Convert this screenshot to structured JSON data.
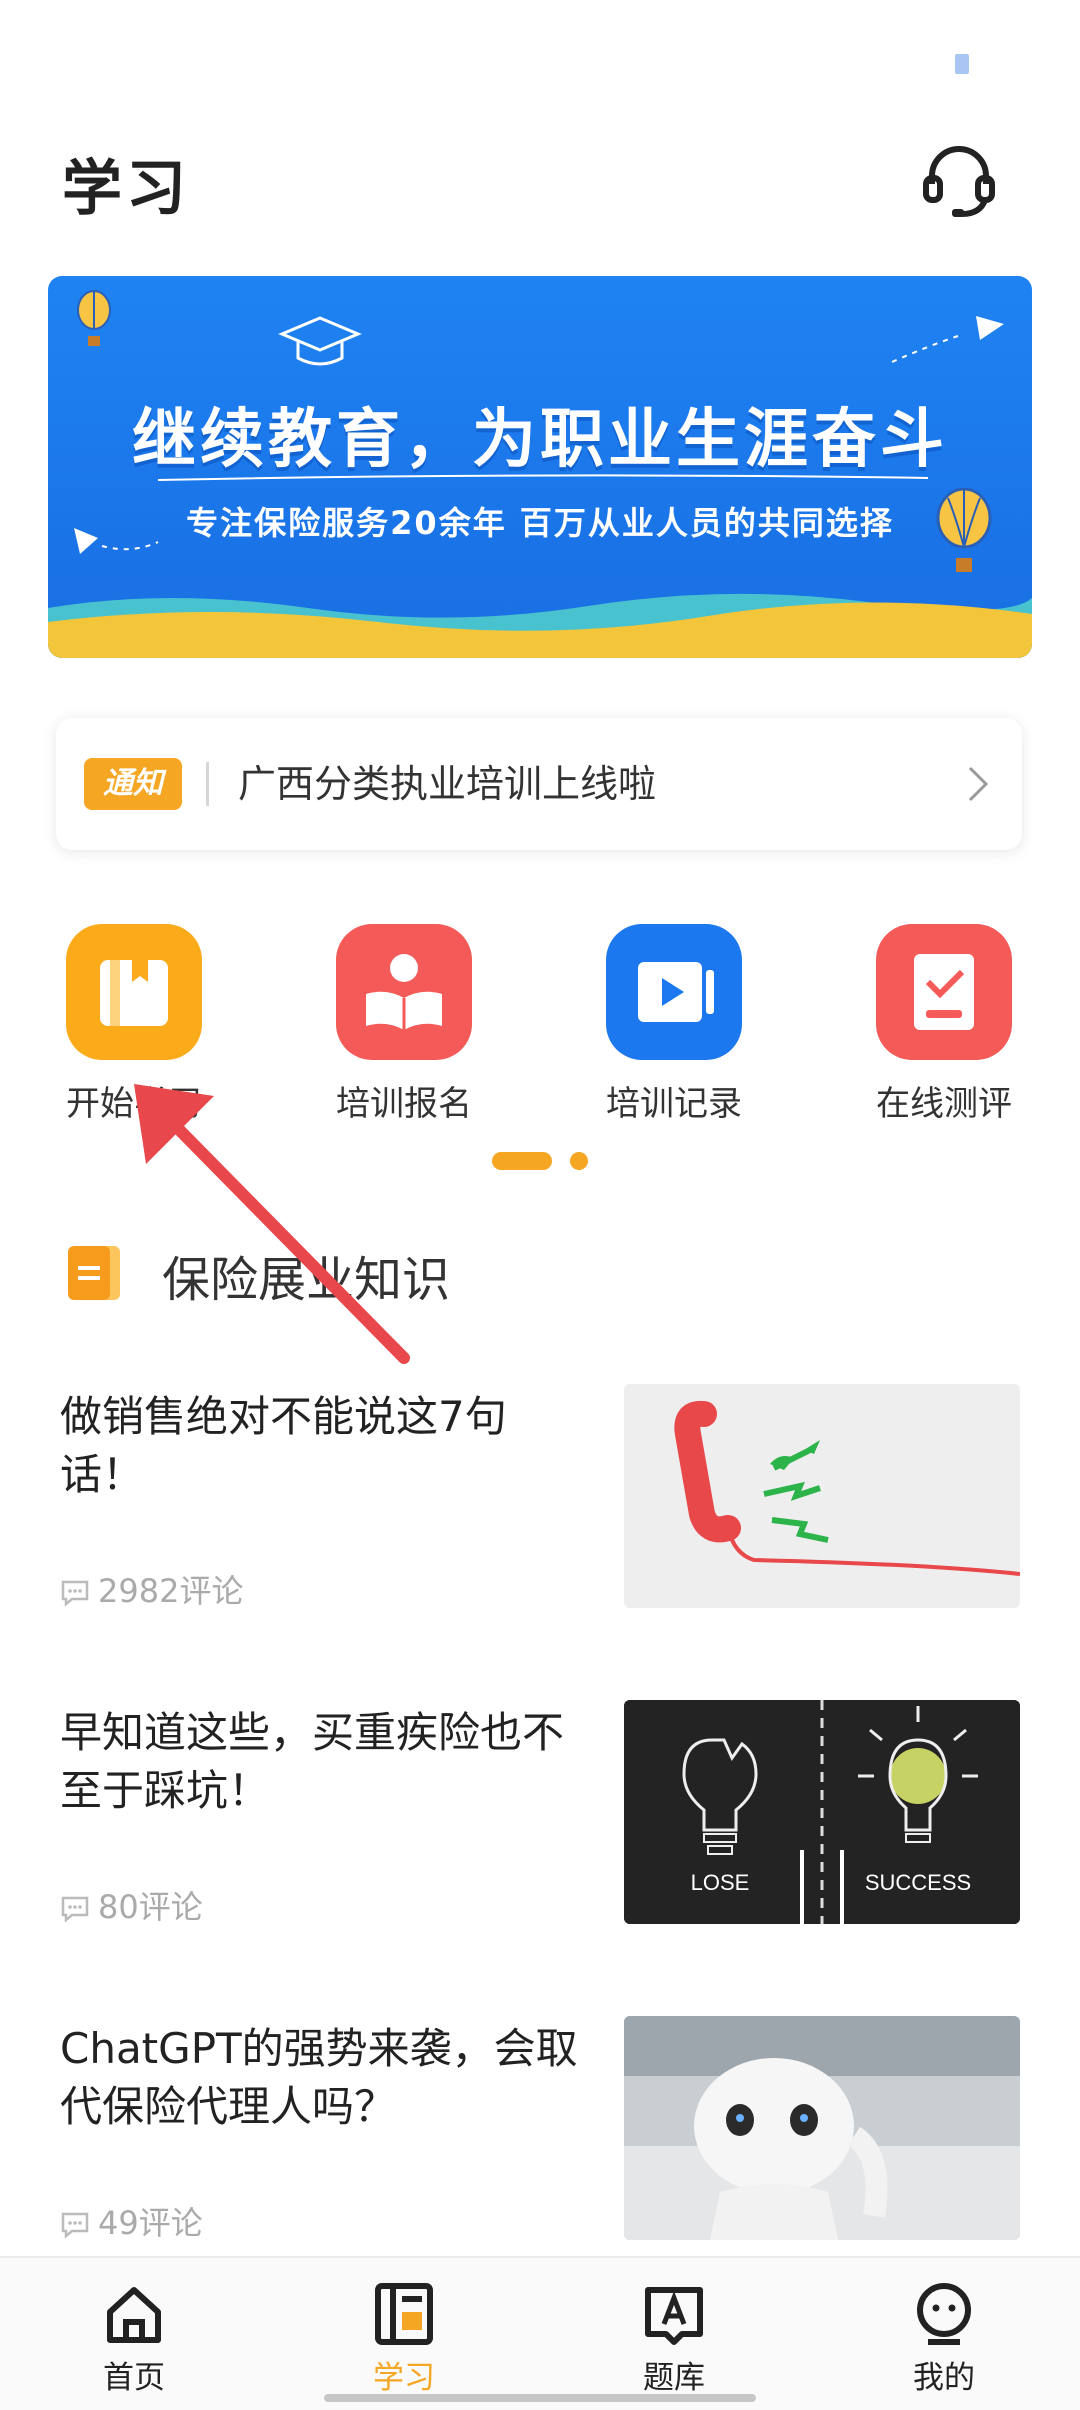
{
  "header": {
    "title": "学习"
  },
  "banner": {
    "title": "继续教育，为职业生涯奋斗",
    "subtitle": "专注保险服务20余年   百万从业人员的共同选择"
  },
  "notice": {
    "badge": "通知",
    "text": "广西分类执业培训上线啦"
  },
  "quick_menu": [
    {
      "label": "开始学习",
      "icon": "book-icon",
      "color": "#fbab1a"
    },
    {
      "label": "培训报名",
      "icon": "reader-icon",
      "color": "#f45a58"
    },
    {
      "label": "培训记录",
      "icon": "video-play-icon",
      "color": "#1c78ee"
    },
    {
      "label": "在线测评",
      "icon": "checklist-icon",
      "color": "#f45a58"
    }
  ],
  "section": {
    "title": "保险展业知识"
  },
  "articles": [
    {
      "title": "做销售绝对不能说这7句话！",
      "comments": "2982评论",
      "image": "telephone-photo"
    },
    {
      "title": "早知道这些，买重疾险也不至于踩坑！",
      "comments": "80评论",
      "image": "lightbulb-lose-success-photo",
      "image_text_left": "LOSE",
      "image_text_right": "SUCCESS"
    },
    {
      "title": "ChatGPT的强势来袭，会取代保险代理人吗？",
      "comments": "49评论",
      "image": "robot-photo"
    }
  ],
  "tabbar": [
    {
      "label": "首页",
      "icon": "home-icon",
      "active": false
    },
    {
      "label": "学习",
      "icon": "study-icon",
      "active": true
    },
    {
      "label": "题库",
      "icon": "question-bank-icon",
      "active": false
    },
    {
      "label": "我的",
      "icon": "profile-icon",
      "active": false
    }
  ],
  "colors": {
    "accent": "#f5a623",
    "banner_blue": "#1a74e8",
    "annotation_red": "#e8474b"
  }
}
